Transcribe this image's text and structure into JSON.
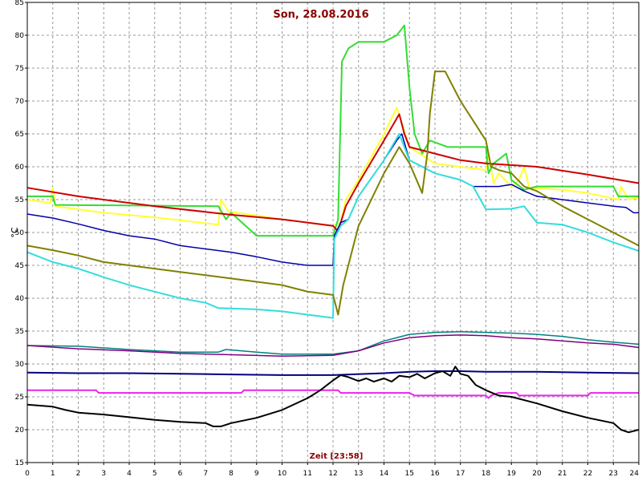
{
  "chart_data": {
    "type": "line",
    "title": "Son, 28.08.2016",
    "xlabel": "Zeit [23:58]",
    "ylabel": "°C",
    "xlim": [
      0,
      24
    ],
    "ylim": [
      15,
      85
    ],
    "x_ticks": [
      "0",
      "1",
      "2",
      "3",
      "4",
      "5",
      "6",
      "7",
      "8",
      "9",
      "10",
      "11",
      "12",
      "13",
      "14",
      "15",
      "16",
      "17",
      "18",
      "19",
      "20",
      "21",
      "22",
      "23",
      "24"
    ],
    "y_ticks": [
      "15",
      "20",
      "25",
      "30",
      "35",
      "40",
      "45",
      "50",
      "55",
      "60",
      "65",
      "70",
      "75",
      "80",
      "85"
    ],
    "grid": true,
    "series": [
      {
        "color": "#ffff33",
        "width": 2,
        "points": [
          [
            0,
            55
          ],
          [
            0.9,
            54.5
          ],
          [
            1,
            56.8
          ],
          [
            1.1,
            54
          ],
          [
            3,
            53
          ],
          [
            5,
            52.3
          ],
          [
            7.5,
            51.2
          ],
          [
            7.6,
            55
          ],
          [
            7.9,
            53.2
          ],
          [
            10,
            52
          ],
          [
            12,
            51
          ],
          [
            12.3,
            51.5
          ],
          [
            12.5,
            55
          ],
          [
            13,
            58
          ],
          [
            14,
            65
          ],
          [
            14.5,
            69
          ],
          [
            15,
            63
          ],
          [
            16,
            60.5
          ],
          [
            17,
            60
          ],
          [
            18,
            59.5
          ],
          [
            18.1,
            62
          ],
          [
            18.3,
            57.5
          ],
          [
            18.5,
            59
          ],
          [
            19,
            57
          ],
          [
            19.3,
            58
          ],
          [
            19.5,
            60
          ],
          [
            19.7,
            56.8
          ],
          [
            21,
            56.5
          ],
          [
            22,
            56
          ],
          [
            23.2,
            55
          ],
          [
            23.3,
            57
          ],
          [
            23.6,
            55
          ],
          [
            24,
            55.3
          ]
        ]
      },
      {
        "color": "#33dd33",
        "width": 2,
        "points": [
          [
            0,
            55.5
          ],
          [
            1,
            55.5
          ],
          [
            1.1,
            54.2
          ],
          [
            7.5,
            54
          ],
          [
            7.8,
            52
          ],
          [
            8,
            53
          ],
          [
            9,
            49.5
          ],
          [
            12,
            49.5
          ],
          [
            12.2,
            52
          ],
          [
            12.35,
            76
          ],
          [
            12.6,
            78
          ],
          [
            13,
            79
          ],
          [
            14,
            79
          ],
          [
            14.5,
            80
          ],
          [
            14.8,
            81.5
          ],
          [
            15,
            72
          ],
          [
            15.2,
            65
          ],
          [
            15.5,
            62
          ],
          [
            15.8,
            64
          ],
          [
            16.5,
            63
          ],
          [
            18,
            63
          ],
          [
            18.1,
            59
          ],
          [
            18.3,
            60.5
          ],
          [
            18.8,
            62
          ],
          [
            19,
            58
          ],
          [
            19.5,
            56.5
          ],
          [
            20,
            57
          ],
          [
            23,
            57
          ],
          [
            23.2,
            55.5
          ],
          [
            24,
            55.5
          ]
        ]
      },
      {
        "color": "#cc0000",
        "width": 2,
        "points": [
          [
            0,
            56.8
          ],
          [
            2,
            55.5
          ],
          [
            5,
            54
          ],
          [
            8,
            52.7
          ],
          [
            10,
            52
          ],
          [
            12,
            51
          ],
          [
            12.2,
            50.2
          ],
          [
            12.5,
            54
          ],
          [
            13,
            57.5
          ],
          [
            14,
            64
          ],
          [
            14.6,
            68
          ],
          [
            14.8,
            65
          ],
          [
            15,
            63
          ],
          [
            16,
            62
          ],
          [
            17,
            61
          ],
          [
            18,
            60.5
          ],
          [
            20,
            60
          ],
          [
            22,
            58.8
          ],
          [
            24,
            57.5
          ]
        ]
      },
      {
        "color": "#0000aa",
        "width": 1.5,
        "points": [
          [
            0,
            52.8
          ],
          [
            1,
            52.2
          ],
          [
            2,
            51.3
          ],
          [
            3,
            50.3
          ],
          [
            4,
            49.5
          ],
          [
            5,
            49
          ],
          [
            6,
            48
          ],
          [
            7,
            47.5
          ],
          [
            8,
            47
          ],
          [
            9,
            46.3
          ],
          [
            10,
            45.5
          ],
          [
            11,
            45
          ],
          [
            12,
            45
          ],
          [
            12.05,
            49.5
          ],
          [
            12.3,
            51.5
          ],
          [
            12.6,
            52
          ],
          [
            13,
            55.5
          ],
          [
            14,
            61
          ],
          [
            14.5,
            64
          ],
          [
            14.7,
            65
          ],
          [
            15,
            61
          ],
          [
            16,
            59
          ],
          [
            17,
            58
          ],
          [
            17.5,
            57
          ],
          [
            18,
            57
          ],
          [
            18.5,
            57
          ],
          [
            19,
            57.3
          ],
          [
            19.5,
            56.3
          ],
          [
            20,
            55.5
          ],
          [
            21,
            55
          ],
          [
            22,
            54.5
          ],
          [
            23,
            54
          ],
          [
            23.5,
            53.8
          ],
          [
            23.8,
            53
          ],
          [
            24,
            53
          ]
        ]
      },
      {
        "color": "#33dddd",
        "width": 2,
        "points": [
          [
            0,
            47
          ],
          [
            1,
            45.5
          ],
          [
            2,
            44.5
          ],
          [
            3,
            43.2
          ],
          [
            4,
            42
          ],
          [
            5,
            41
          ],
          [
            6,
            40
          ],
          [
            7,
            39.3
          ],
          [
            7.5,
            38.5
          ],
          [
            9,
            38.3
          ],
          [
            10,
            38
          ],
          [
            11,
            37.5
          ],
          [
            12,
            37
          ],
          [
            12.05,
            49
          ],
          [
            12.3,
            51
          ],
          [
            12.6,
            52
          ],
          [
            13,
            55.5
          ],
          [
            14,
            61
          ],
          [
            14.6,
            65
          ],
          [
            15,
            61
          ],
          [
            16,
            59
          ],
          [
            17,
            58
          ],
          [
            17.5,
            57
          ],
          [
            18,
            53.5
          ],
          [
            19,
            53.6
          ],
          [
            19.5,
            54
          ],
          [
            20,
            51.5
          ],
          [
            21,
            51.2
          ],
          [
            22,
            50
          ],
          [
            23,
            48.5
          ],
          [
            24,
            47.2
          ]
        ]
      },
      {
        "color": "#808000",
        "width": 2,
        "points": [
          [
            0,
            48
          ],
          [
            1,
            47.3
          ],
          [
            2,
            46.5
          ],
          [
            3,
            45.5
          ],
          [
            4,
            45
          ],
          [
            5,
            44.5
          ],
          [
            6,
            44
          ],
          [
            7,
            43.5
          ],
          [
            8,
            43
          ],
          [
            9,
            42.5
          ],
          [
            10,
            42
          ],
          [
            11,
            41
          ],
          [
            12,
            40.5
          ],
          [
            12.1,
            39
          ],
          [
            12.2,
            37.5
          ],
          [
            12.4,
            42
          ],
          [
            12.8,
            48
          ],
          [
            13,
            51
          ],
          [
            14,
            59
          ],
          [
            14.6,
            63
          ],
          [
            15,
            60.5
          ],
          [
            15.5,
            56
          ],
          [
            15.7,
            62
          ],
          [
            15.8,
            68
          ],
          [
            16,
            74.5
          ],
          [
            16.4,
            74.5
          ],
          [
            17,
            70
          ],
          [
            18,
            64
          ],
          [
            18.2,
            60
          ],
          [
            18.5,
            59.5
          ],
          [
            19,
            59
          ],
          [
            19.5,
            57
          ],
          [
            20,
            56.3
          ],
          [
            21,
            54
          ],
          [
            22,
            52
          ],
          [
            23,
            50
          ],
          [
            24,
            48
          ]
        ]
      },
      {
        "color": "#008080",
        "width": 1.5,
        "points": [
          [
            0,
            32.8
          ],
          [
            2,
            32.7
          ],
          [
            4,
            32.2
          ],
          [
            6,
            31.8
          ],
          [
            7.5,
            31.8
          ],
          [
            7.8,
            32.2
          ],
          [
            9,
            31.8
          ],
          [
            10,
            31.5
          ],
          [
            11,
            31.5
          ],
          [
            12,
            31.5
          ],
          [
            13,
            32
          ],
          [
            14,
            33.5
          ],
          [
            15,
            34.5
          ],
          [
            16,
            34.8
          ],
          [
            17,
            34.9
          ],
          [
            18,
            34.8
          ],
          [
            19,
            34.7
          ],
          [
            20,
            34.5
          ],
          [
            21,
            34.2
          ],
          [
            22,
            33.7
          ],
          [
            23,
            33.3
          ],
          [
            24,
            33
          ]
        ]
      },
      {
        "color": "#800080",
        "width": 1.5,
        "points": [
          [
            0,
            32.8
          ],
          [
            2,
            32.3
          ],
          [
            4,
            32
          ],
          [
            6,
            31.6
          ],
          [
            8,
            31.4
          ],
          [
            10,
            31.2
          ],
          [
            12,
            31.3
          ],
          [
            13,
            32
          ],
          [
            14,
            33.2
          ],
          [
            15,
            34
          ],
          [
            16,
            34.3
          ],
          [
            17,
            34.4
          ],
          [
            18,
            34.3
          ],
          [
            19,
            34
          ],
          [
            20,
            33.8
          ],
          [
            21,
            33.5
          ],
          [
            22,
            33.2
          ],
          [
            23,
            33
          ],
          [
            24,
            32.5
          ]
        ]
      },
      {
        "color": "#000080",
        "width": 2,
        "points": [
          [
            0,
            28.7
          ],
          [
            2,
            28.6
          ],
          [
            4,
            28.6
          ],
          [
            6,
            28.5
          ],
          [
            8,
            28.4
          ],
          [
            10,
            28.3
          ],
          [
            12,
            28.3
          ],
          [
            14,
            28.6
          ],
          [
            15,
            28.8
          ],
          [
            16,
            28.9
          ],
          [
            17,
            28.9
          ],
          [
            18,
            28.8
          ],
          [
            20,
            28.8
          ],
          [
            22,
            28.7
          ],
          [
            24,
            28.6
          ]
        ]
      },
      {
        "color": "#ee22ee",
        "width": 2,
        "points": [
          [
            0,
            26
          ],
          [
            2,
            26
          ],
          [
            2.7,
            26
          ],
          [
            2.8,
            25.6
          ],
          [
            8.4,
            25.6
          ],
          [
            8.5,
            26
          ],
          [
            12.2,
            26
          ],
          [
            12.3,
            25.6
          ],
          [
            15,
            25.6
          ],
          [
            15.2,
            25.2
          ],
          [
            18,
            25.2
          ],
          [
            18.1,
            24.8
          ],
          [
            18.2,
            25.2
          ],
          [
            18.5,
            25.6
          ],
          [
            19.2,
            25.6
          ],
          [
            19.3,
            25.2
          ],
          [
            22,
            25.2
          ],
          [
            22.1,
            25.6
          ],
          [
            24,
            25.6
          ]
        ]
      },
      {
        "color": "#000000",
        "width": 2,
        "points": [
          [
            0,
            23.8
          ],
          [
            1,
            23.5
          ],
          [
            1.5,
            23
          ],
          [
            2,
            22.6
          ],
          [
            3,
            22.3
          ],
          [
            4,
            21.9
          ],
          [
            5,
            21.5
          ],
          [
            6,
            21.2
          ],
          [
            7,
            21
          ],
          [
            7.3,
            20.5
          ],
          [
            7.6,
            20.5
          ],
          [
            8,
            21
          ],
          [
            9,
            21.8
          ],
          [
            10,
            23
          ],
          [
            11,
            24.8
          ],
          [
            11.5,
            26
          ],
          [
            12,
            27.5
          ],
          [
            12.3,
            28.3
          ],
          [
            12.6,
            28
          ],
          [
            13,
            27.4
          ],
          [
            13.3,
            27.8
          ],
          [
            13.6,
            27.3
          ],
          [
            14,
            27.8
          ],
          [
            14.3,
            27.3
          ],
          [
            14.6,
            28.2
          ],
          [
            15,
            28
          ],
          [
            15.3,
            28.5
          ],
          [
            15.6,
            27.8
          ],
          [
            16,
            28.6
          ],
          [
            16.3,
            28.9
          ],
          [
            16.6,
            28.2
          ],
          [
            16.8,
            29.6
          ],
          [
            17,
            28.5
          ],
          [
            17.3,
            28.2
          ],
          [
            17.6,
            26.8
          ],
          [
            18,
            26
          ],
          [
            18.5,
            25.2
          ],
          [
            19,
            25
          ],
          [
            20,
            24
          ],
          [
            21,
            22.8
          ],
          [
            22,
            21.8
          ],
          [
            23,
            21
          ],
          [
            23.3,
            20
          ],
          [
            23.6,
            19.6
          ],
          [
            24,
            20
          ]
        ]
      }
    ]
  }
}
